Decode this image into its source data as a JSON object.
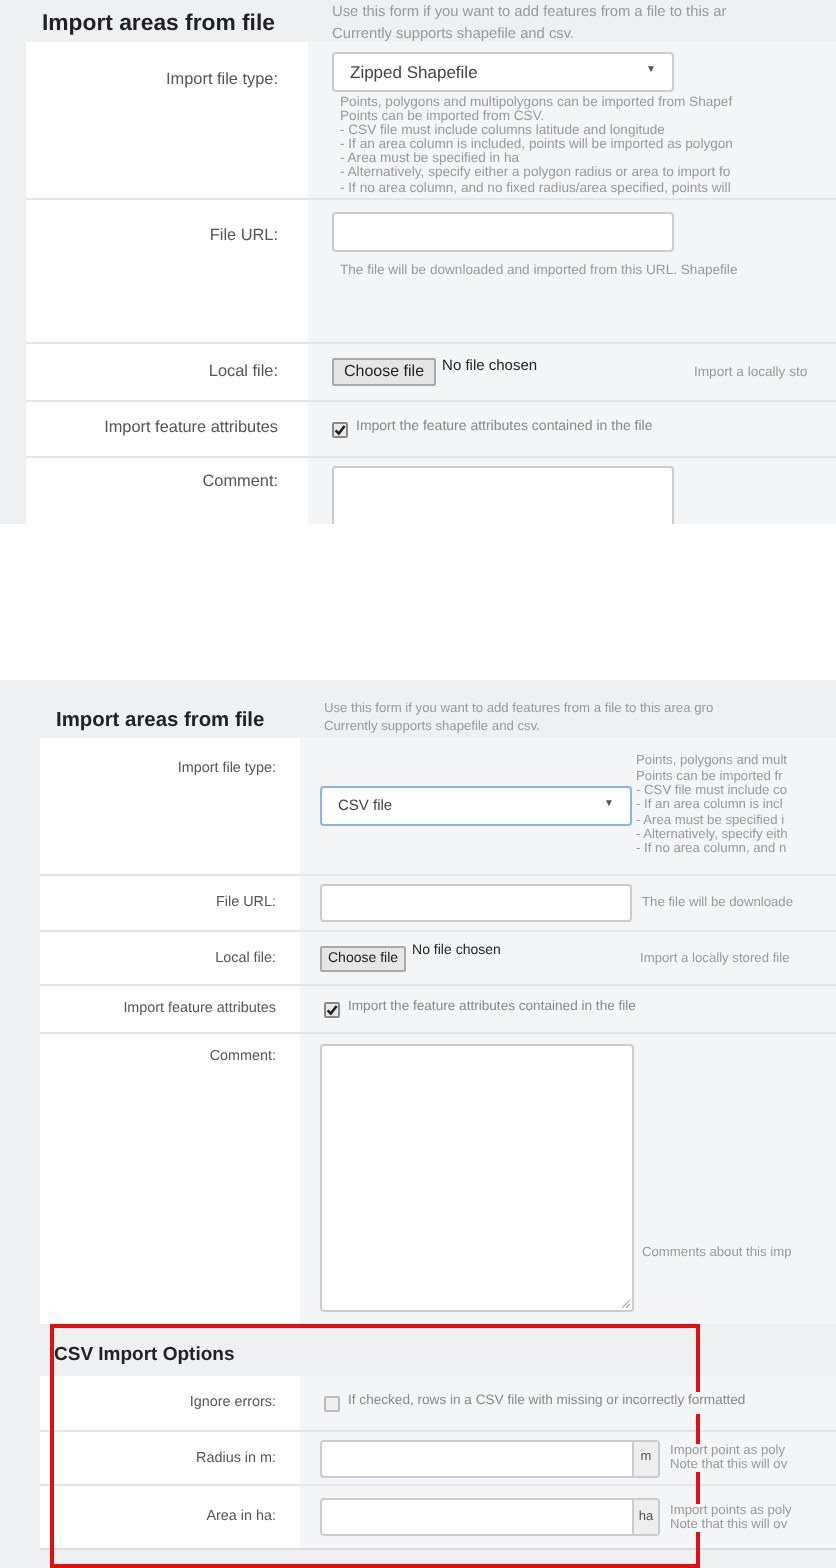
{
  "screens": [
    {
      "title": "Import areas from file",
      "intro": [
        "Use this form if you want to add features from a file to this ar",
        "Currently supports shapefile and csv."
      ],
      "fields": [
        {
          "kind": "select",
          "label": "Import file type:",
          "value": "Zipped Shapefile",
          "arrow": "▼",
          "help": [
            "Points, polygons and multipolygons can be imported from Shapef",
            "Points can be imported from CSV.",
            "- CSV file must include columns latitude and longitude",
            "- If an area column is included, points will be imported as polygon",
            "- Area must be specified in ha",
            "- Alternatively, specify either a polygon radius or area to import fo",
            "- If no area column, and no fixed radius/area specified, points will"
          ]
        },
        {
          "kind": "text",
          "label": "File URL:",
          "help": [
            "The file will be downloaded and imported from this URL. Shapefile"
          ]
        },
        {
          "kind": "file",
          "label": "Local file:",
          "button": "Choose file",
          "status": "No file chosen",
          "help": [
            "Import a locally sto"
          ]
        },
        {
          "kind": "checkbox",
          "label": "Import feature attributes",
          "checked": true,
          "text": "Import the feature attributes contained in the file"
        },
        {
          "kind": "textarea",
          "label": "Comment:"
        }
      ]
    },
    {
      "title": "Import areas from file",
      "intro": [
        "Use this form if you want to add features from a file to this area gro",
        "Currently supports shapefile and csv."
      ],
      "fields": [
        {
          "kind": "select",
          "label": "Import file type:",
          "value": "CSV file",
          "arrow": "▼",
          "help": [
            "Points, polygons and mult",
            "Points can be imported fr",
            "- CSV file must include co",
            "- If an area column is incl",
            "- Area must be specified i",
            "- Alternatively, specify eith",
            "- If no area column, and n"
          ]
        },
        {
          "kind": "text",
          "label": "File URL:",
          "help": [
            "The file will be downloade"
          ]
        },
        {
          "kind": "file",
          "label": "Local file:",
          "button": "Choose file",
          "status": "No file chosen",
          "help": [
            "Import a locally stored file"
          ]
        },
        {
          "kind": "checkbox",
          "label": "Import feature attributes",
          "checked": true,
          "text": "Import the feature attributes contained in the file"
        },
        {
          "kind": "textarea",
          "label": "Comment:",
          "help": [
            "Comments about this imp"
          ]
        }
      ],
      "options": {
        "title": "CSV Import Options",
        "fields": [
          {
            "kind": "checkbox",
            "label": "Ignore errors:",
            "checked": false,
            "text": "If checked, rows in a CSV file with missing or incorrectly formatted"
          },
          {
            "kind": "unit",
            "label": "Radius in m:",
            "unit": "m",
            "help": [
              "Import point as poly",
              "Note that this will ov"
            ]
          },
          {
            "kind": "unit",
            "label": "Area in ha:",
            "unit": "ha",
            "help": [
              "Import points as poly",
              "Note that this will ov"
            ]
          }
        ]
      }
    }
  ]
}
